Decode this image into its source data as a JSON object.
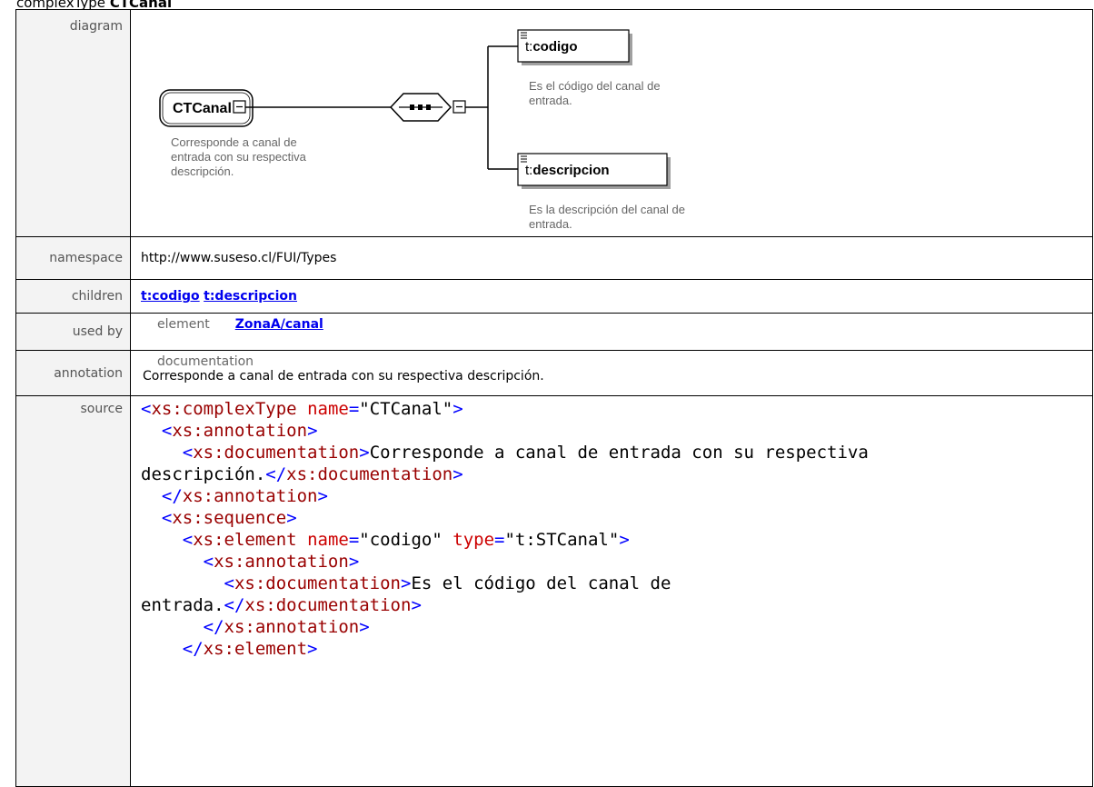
{
  "header": {
    "prefix": "complexType",
    "name": "CTCanal"
  },
  "rows": {
    "diagram": {
      "label": "diagram"
    },
    "namespace": {
      "label": "namespace",
      "value": "http://www.suseso.cl/FUI/Types"
    },
    "children": {
      "label": "children",
      "items": [
        "t:codigo",
        "t:descripcion"
      ]
    },
    "used_by": {
      "label": "used by",
      "kind": "element",
      "link": "ZonaA/canal"
    },
    "annotation": {
      "label": "annotation",
      "kind": "documentation",
      "text": "Corresponde a canal de entrada con su respectiva descripción."
    },
    "source": {
      "label": "source"
    }
  },
  "diagram": {
    "root": {
      "name": "CTCanal",
      "doc": [
        "Corresponde a canal de",
        "entrada con su respectiva",
        "descripción."
      ]
    },
    "children": [
      {
        "prefix": "t:",
        "name": "codigo",
        "doc": [
          "Es el código del canal de",
          "entrada."
        ]
      },
      {
        "prefix": "t:",
        "name": "descripcion",
        "doc": [
          "Es la descripción del canal de",
          "entrada."
        ]
      }
    ]
  },
  "source": {
    "l1_tag": "xs:complexType",
    "l1_attr": "name",
    "l1_val": "\"CTCanal\"",
    "l2_tag": "xs:annotation",
    "l3_tag": "xs:documentation",
    "l3_text": "Corresponde a canal de entrada con su respectiva",
    "l4_text": "descripción.",
    "l4_close": "xs:documentation",
    "l5_close": "xs:annotation",
    "l6_tag": "xs:sequence",
    "l7_tag": "xs:element",
    "l7_attr1": "name",
    "l7_val1": "\"codigo\"",
    "l7_attr2": "type",
    "l7_val2": "\"t:STCanal\"",
    "l8_tag": "xs:annotation",
    "l9_tag": "xs:documentation",
    "l9_text": "Es el código del canal de",
    "l10_text": "entrada.",
    "l10_close": "xs:documentation",
    "l11_close": "xs:annotation",
    "l12_close": "xs:element"
  }
}
